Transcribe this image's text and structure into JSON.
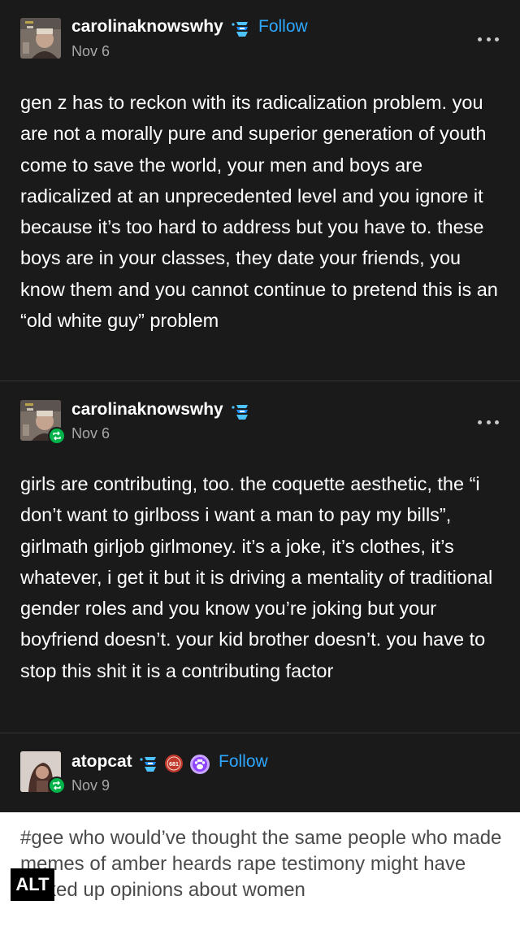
{
  "posts": [
    {
      "username": "carolinaknowswhy",
      "follow_label": "Follow",
      "date": "Nov 6",
      "body": "gen z has to reckon with its radicalization problem. you are not a morally pure and superior generation of youth come to save the world, your men and boys are radicalized at an unprecedented level and you ignore it because it’s too hard to address but you have to. these boys are in your classes, they date your friends, you know them and you cannot continue to pretend this is an “old white guy” problem"
    },
    {
      "username": "carolinaknowswhy",
      "date": "Nov 6",
      "body": "girls are contributing, too. the coquette aesthetic, the “i don’t want to girlboss i want a man to pay my bills”, girlmath girljob girlmoney. it’s a joke, it’s clothes, it’s whatever, i get it but it is driving a mentality of traditional gender roles and you know you’re joking but your boyfriend doesn’t. your kid brother doesn’t. you have to stop this shit it is a contributing factor"
    },
    {
      "username": "atopcat",
      "follow_label": "Follow",
      "date": "Nov 9",
      "badge_text": "681",
      "tags": "#gee who would’ve thought the same people who made memes of amber heards rape testimony might have fucked up opinions about women",
      "alt_label": "ALT"
    }
  ],
  "icons": {
    "more": "more-options-icon",
    "reblog": "reblog-icon",
    "blue_badge": "blue-checkmark-badge-icon",
    "red_badge": "red-badge-icon",
    "paw_badge": "paw-badge-icon"
  },
  "colors": {
    "background": "#1a1a1a",
    "follow": "#2ea7ff",
    "date": "#a8a8a8",
    "reblog": "#00b34a",
    "tags_background": "#ffffff",
    "tags_text": "#4a4a4a"
  }
}
